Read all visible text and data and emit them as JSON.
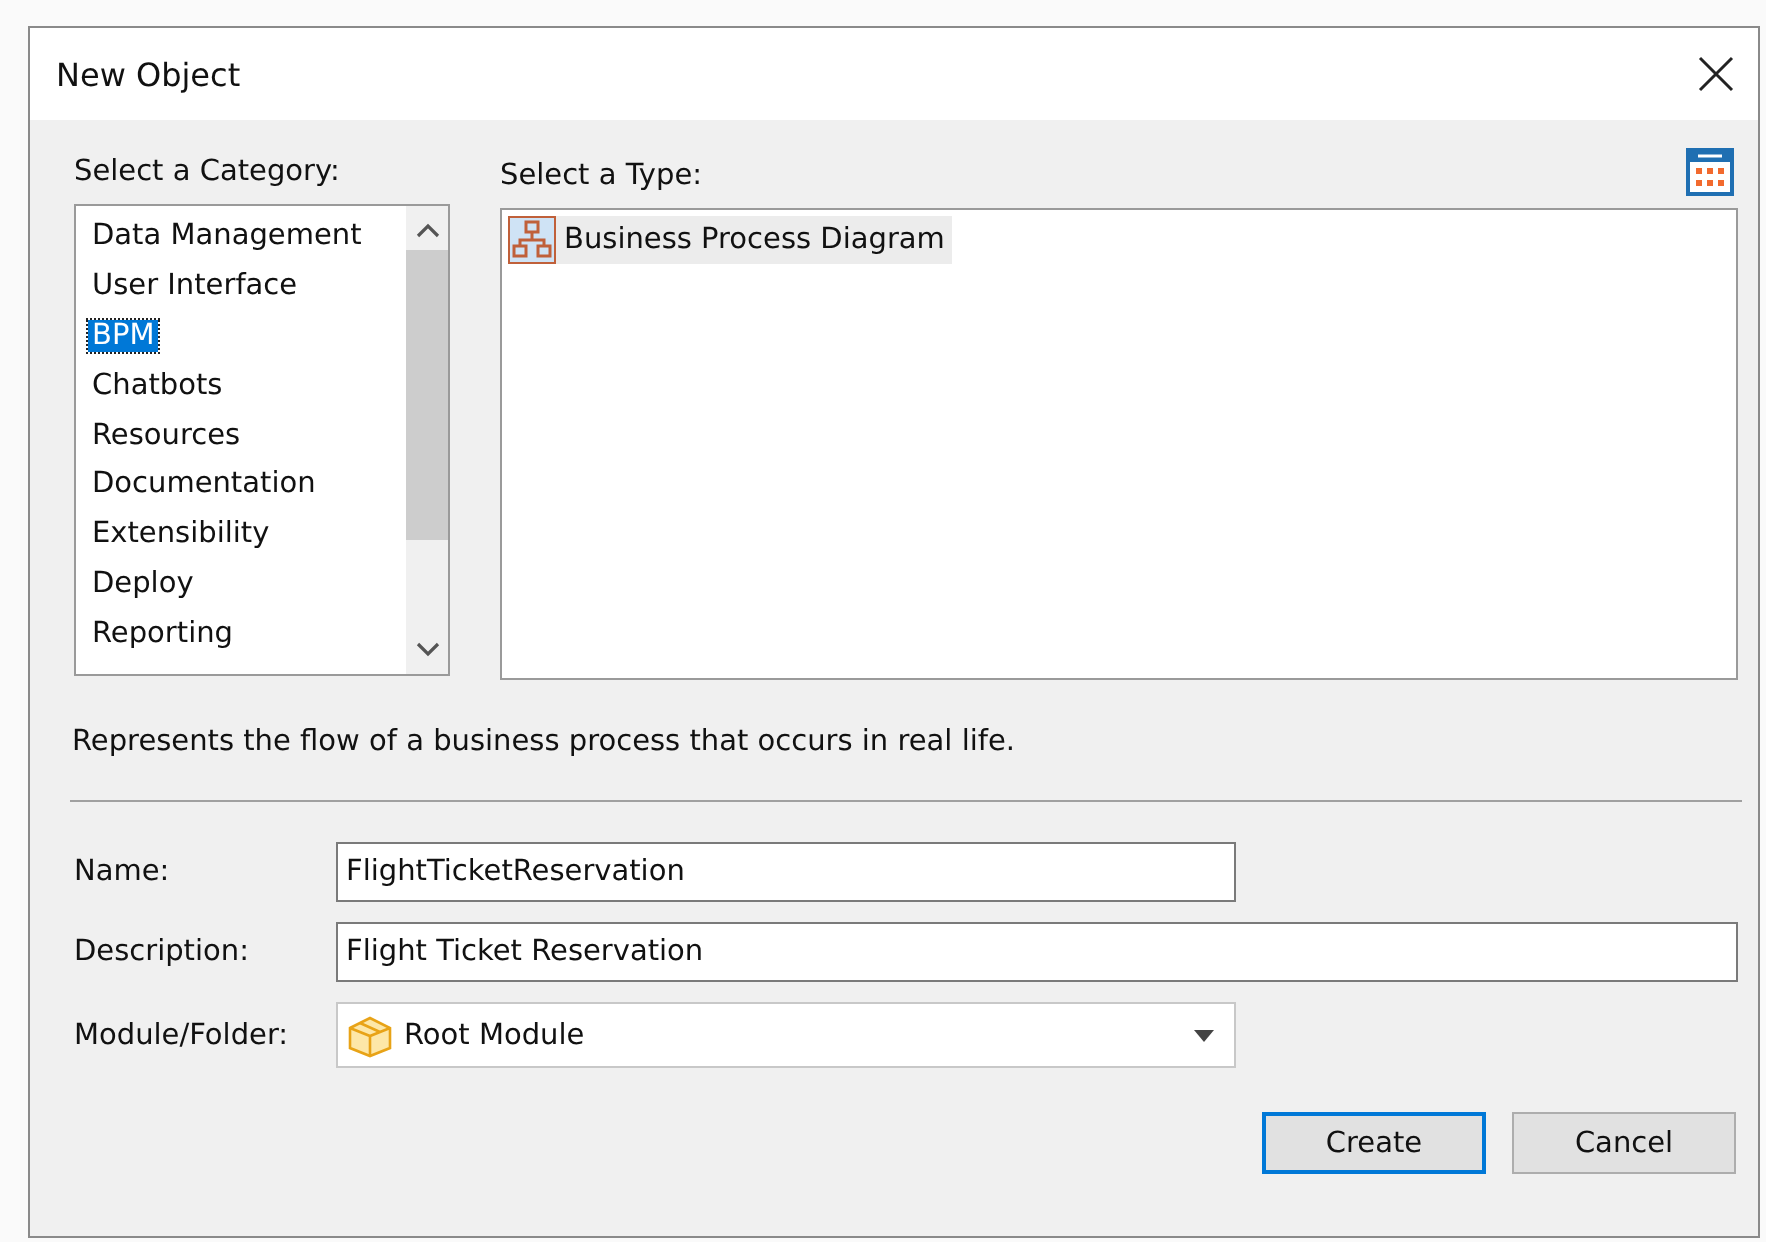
{
  "window": {
    "title": "New Object"
  },
  "category": {
    "label": "Select a Category:",
    "items": [
      {
        "label": "Data Management",
        "selected": false
      },
      {
        "label": "User Interface",
        "selected": false
      },
      {
        "label": "BPM",
        "selected": true
      },
      {
        "label": "Chatbots",
        "selected": false
      },
      {
        "label": "Resources",
        "selected": false
      },
      {
        "label": "Documentation",
        "selected": false
      },
      {
        "label": "Extensibility",
        "selected": false
      },
      {
        "label": "Deploy",
        "selected": false
      },
      {
        "label": "Reporting",
        "selected": false
      }
    ]
  },
  "type": {
    "label": "Select a Type:",
    "items": [
      {
        "label": "Business Process Diagram",
        "selected": true
      }
    ]
  },
  "description_text": "Represents the flow of a business process that occurs in real life.",
  "form": [
    {
      "kind": "text",
      "label": "Name:",
      "value": "FlightTicketReservation"
    },
    {
      "kind": "text",
      "label": "Description:",
      "value": "Flight Ticket Reservation"
    },
    {
      "kind": "combo",
      "label": "Module/Folder:",
      "value": "Root Module"
    }
  ],
  "buttons": [
    {
      "label": "Create",
      "default": true
    },
    {
      "label": "Cancel",
      "default": false
    }
  ]
}
